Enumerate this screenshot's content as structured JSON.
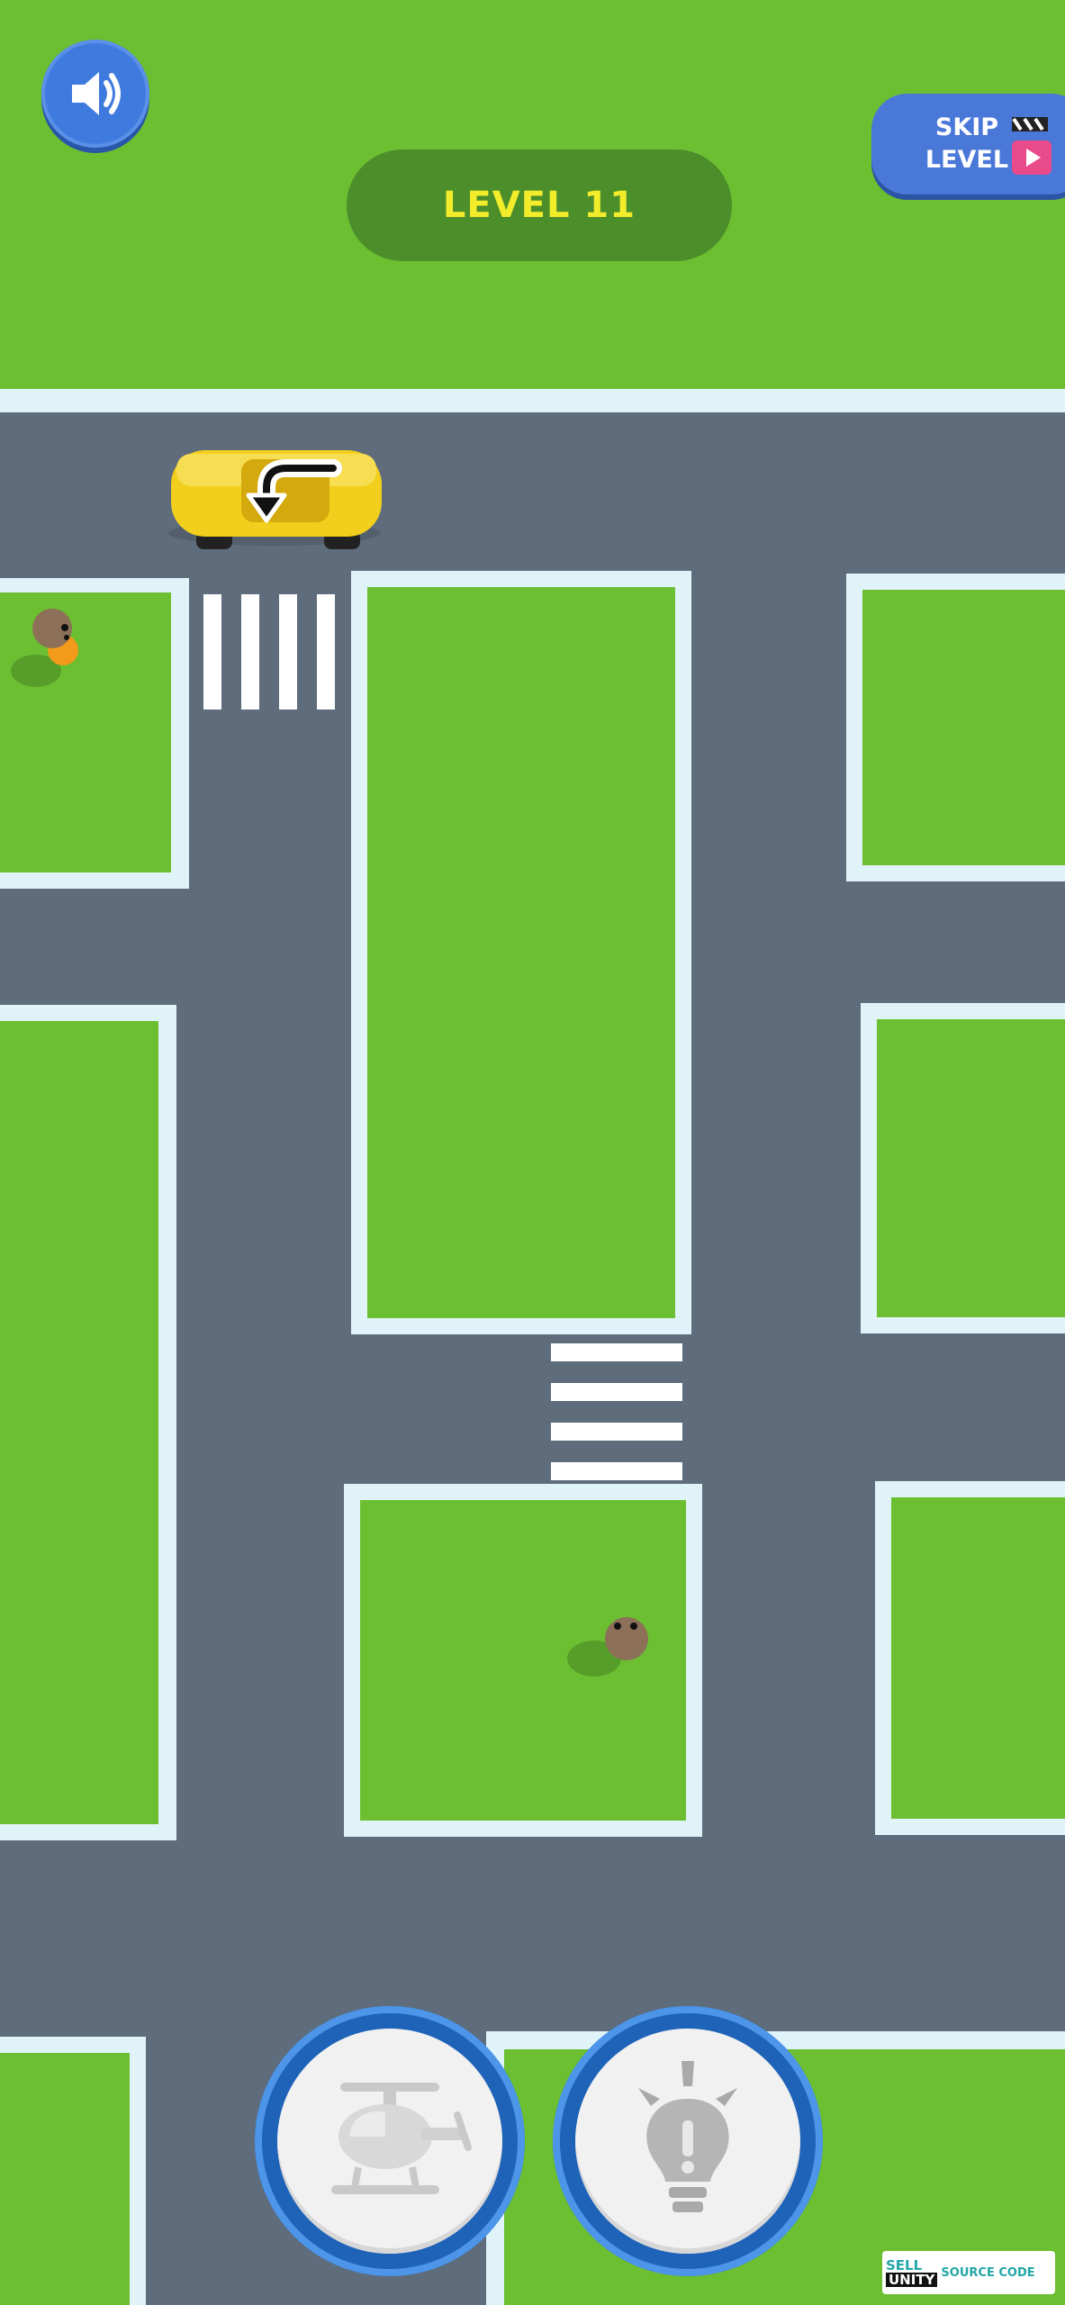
{
  "hud": {
    "level_label": "LEVEL 11",
    "skip_line1": "SKIP",
    "skip_line2": "LEVEL",
    "sound_icon": "speaker-icon",
    "skip_icon": "clapperboard-play-icon",
    "powerups": [
      {
        "name": "helicopter",
        "icon": "helicopter-icon"
      },
      {
        "name": "hint",
        "icon": "lightbulb-icon"
      }
    ]
  },
  "watermark": {
    "line1": "SELL",
    "line2": "UNITY",
    "line3": "SOURCE CODE"
  },
  "colors": {
    "grass": "#6dbf32",
    "road": "#5f6c7b",
    "curb": "#dff3f8",
    "car": "#f2cf1c",
    "hud_blue": "#3f7bde",
    "level_pill": "#4b8e2a",
    "level_text": "#f2ec2a"
  }
}
